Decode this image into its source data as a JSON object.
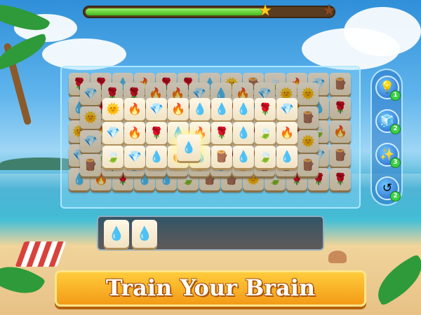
{
  "progress": {
    "value": 0.72,
    "stars_earned": 1,
    "stars_total": 2
  },
  "icons": {
    "star_filled": "star-filled-icon",
    "star_empty": "star-empty-icon",
    "tile_water": "water-drop-icon",
    "tile_fire": "fire-icon",
    "tile_leaf": "leaf-icon",
    "tile_rose": "rose-icon",
    "tile_wood": "wood-log-icon",
    "tile_gem": "gem-icon",
    "tile_sun": "sun-icon"
  },
  "boosters": [
    {
      "name": "hint-booster",
      "icon": "lightbulb-icon",
      "count": "1"
    },
    {
      "name": "shuffle-booster",
      "icon": "cube-icon",
      "count": "2"
    },
    {
      "name": "magic-booster",
      "icon": "wand-icon",
      "count": "3"
    },
    {
      "name": "undo-booster",
      "icon": "undo-icon",
      "count": "2"
    }
  ],
  "tray": {
    "tiles": [
      "water-drop-icon",
      "water-drop-icon"
    ],
    "capacity": 7
  },
  "banner": {
    "text": "Train Your Brain"
  },
  "colors": {
    "accent": "#f39a16",
    "progress": "#3fb81d",
    "board": "#96dcff"
  }
}
